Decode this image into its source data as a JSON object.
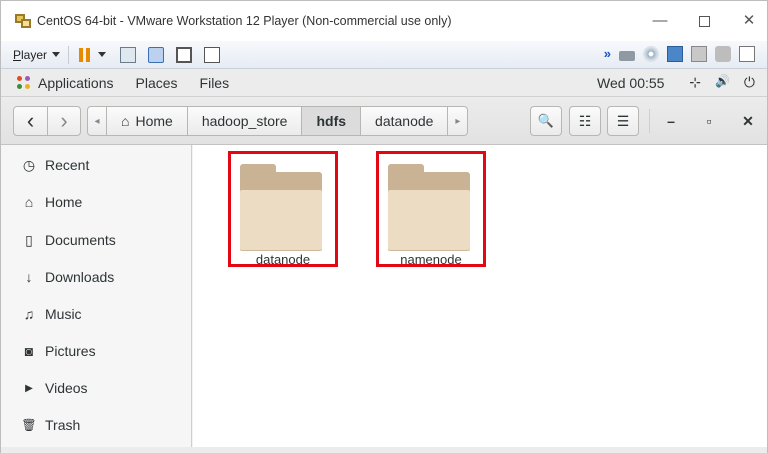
{
  "vm_window": {
    "title": "CentOS 64-bit - VMware Workstation 12 Player (Non-commercial use only)",
    "controls": {
      "minimize": "—",
      "close": "✕"
    }
  },
  "vm_toolbar": {
    "player_label_underlined": "P",
    "player_label_rest": "layer",
    "forward_symbol": "»"
  },
  "gnome_bar": {
    "applications": "Applications",
    "places": "Places",
    "files": "Files",
    "clock": "Wed 00:55",
    "network_icon": "⊹",
    "volume_icon": "🔊",
    "power_icon": "⏻"
  },
  "header": {
    "back_symbol": "‹",
    "forward_symbol": "›",
    "path_prev_symbol": "◂",
    "path_next_symbol": "▸",
    "path": [
      {
        "label": "Home",
        "active": false
      },
      {
        "label": "hadoop_store",
        "active": false
      },
      {
        "label": "hdfs",
        "active": true
      },
      {
        "label": "datanode",
        "active": false
      }
    ],
    "search_symbol": "🔍",
    "view_symbol": "☷",
    "menu_symbol": "☰",
    "window_controls": {
      "minimize": "–",
      "maximize": "▫",
      "close": "✕"
    }
  },
  "sidebar": {
    "items": [
      {
        "label": "Recent",
        "icon": "clock-icon",
        "glyph": "◷"
      },
      {
        "label": "Home",
        "icon": "home-icon",
        "glyph": "⌂"
      },
      {
        "label": "Documents",
        "icon": "document-icon",
        "glyph": "▯"
      },
      {
        "label": "Downloads",
        "icon": "download-icon",
        "glyph": "↓"
      },
      {
        "label": "Music",
        "icon": "music-icon",
        "glyph": "♫"
      },
      {
        "label": "Pictures",
        "icon": "camera-icon",
        "glyph": "◙"
      },
      {
        "label": "Videos",
        "icon": "video-icon",
        "glyph": "▶"
      },
      {
        "label": "Trash",
        "icon": "trash-icon",
        "glyph": "🗑"
      }
    ]
  },
  "content": {
    "folders": [
      {
        "name": "datanode",
        "highlighted": true
      },
      {
        "name": "namenode",
        "highlighted": true
      }
    ],
    "highlight_color": "#e30613",
    "folder_color": "#ecdcc3"
  }
}
